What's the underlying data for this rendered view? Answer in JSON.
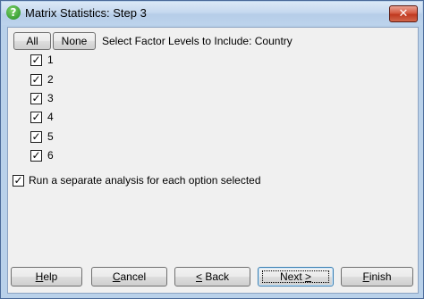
{
  "window": {
    "title": "Matrix Statistics: Step 3",
    "close_glyph": "✕",
    "icon": "help-question-icon"
  },
  "selector": {
    "all_label": "All",
    "none_label": "None",
    "prompt": "Select Factor Levels to Include: Country"
  },
  "levels": [
    {
      "label": "1",
      "checked": true
    },
    {
      "label": "2",
      "checked": true
    },
    {
      "label": "3",
      "checked": true
    },
    {
      "label": "4",
      "checked": true
    },
    {
      "label": "5",
      "checked": true
    },
    {
      "label": "6",
      "checked": true
    }
  ],
  "separate_analysis": {
    "label": "Run a separate analysis for each option selected",
    "checked": true
  },
  "buttons": {
    "help": {
      "pre": "",
      "accel": "H",
      "post": "elp"
    },
    "cancel": {
      "pre": "",
      "accel": "C",
      "post": "ancel"
    },
    "back": {
      "pre": "",
      "accel": "<",
      "post": " Back"
    },
    "next": {
      "pre": "Next ",
      "accel": ">",
      "post": ""
    },
    "finish": {
      "pre": "",
      "accel": "F",
      "post": "inish"
    }
  },
  "check_glyph": "✓"
}
